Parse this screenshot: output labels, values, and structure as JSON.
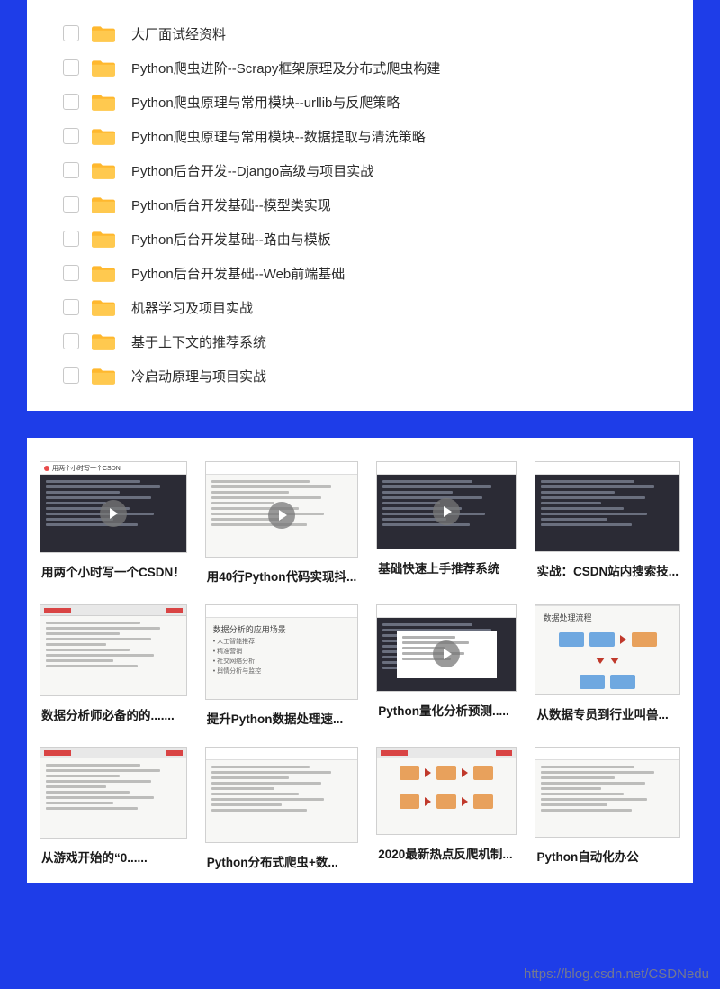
{
  "folders": [
    {
      "label": "大厂面试经资料"
    },
    {
      "label": "Python爬虫进阶--Scrapy框架原理及分布式爬虫构建"
    },
    {
      "label": "Python爬虫原理与常用模块--urllib与反爬策略"
    },
    {
      "label": "Python爬虫原理与常用模块--数据提取与清洗策略"
    },
    {
      "label": "Python后台开发--Django高级与项目实战"
    },
    {
      "label": "Python后台开发基础--模型类实现"
    },
    {
      "label": "Python后台开发基础--路由与模板"
    },
    {
      "label": "Python后台开发基础--Web前端基础"
    },
    {
      "label": "机器学习及项目实战"
    },
    {
      "label": "基于上下文的推荐系统"
    },
    {
      "label": "冷启动原理与项目实战"
    }
  ],
  "videos": [
    {
      "title": "用两个小时写一个CSDN！",
      "style": "dark",
      "play": true,
      "header_logo": true
    },
    {
      "title": "用40行Python代码实现抖...",
      "style": "light",
      "play": true,
      "slide_title": "",
      "code": true
    },
    {
      "title": "基础快速上手推荐系统",
      "style": "dark",
      "play": true
    },
    {
      "title": "实战：CSDN站内搜索技...",
      "style": "dark",
      "play": false
    },
    {
      "title": "数据分析师必备的的.......",
      "style": "light",
      "play": false,
      "redstripe": true,
      "code": true
    },
    {
      "title": "提升Python数据处理速...",
      "style": "light",
      "play": false,
      "slide_title": "数据分析的应用场景",
      "bullets": [
        "• 人工智能推荐",
        "• 精准营销",
        "• 社交网络分析",
        "• 舆情分析与监控"
      ]
    },
    {
      "title": "Python量化分析预测.....",
      "style": "dark",
      "play": true,
      "boxed": true
    },
    {
      "title": "从数据专员到行业叫兽...",
      "style": "light",
      "play": false,
      "diagram": true,
      "slide_title": "数据处理流程"
    },
    {
      "title": "从游戏开始的“0......",
      "style": "light",
      "play": false,
      "redstripe": true,
      "code": true
    },
    {
      "title": "Python分布式爬虫+数...",
      "style": "light",
      "play": false,
      "code": true
    },
    {
      "title": "2020最新热点反爬机制...",
      "style": "light",
      "play": false,
      "redstripe": true,
      "flow": true
    },
    {
      "title": "Python自动化办公",
      "style": "light",
      "play": false,
      "code": true
    }
  ],
  "watermark": "https://blog.csdn.net/CSDNedu"
}
